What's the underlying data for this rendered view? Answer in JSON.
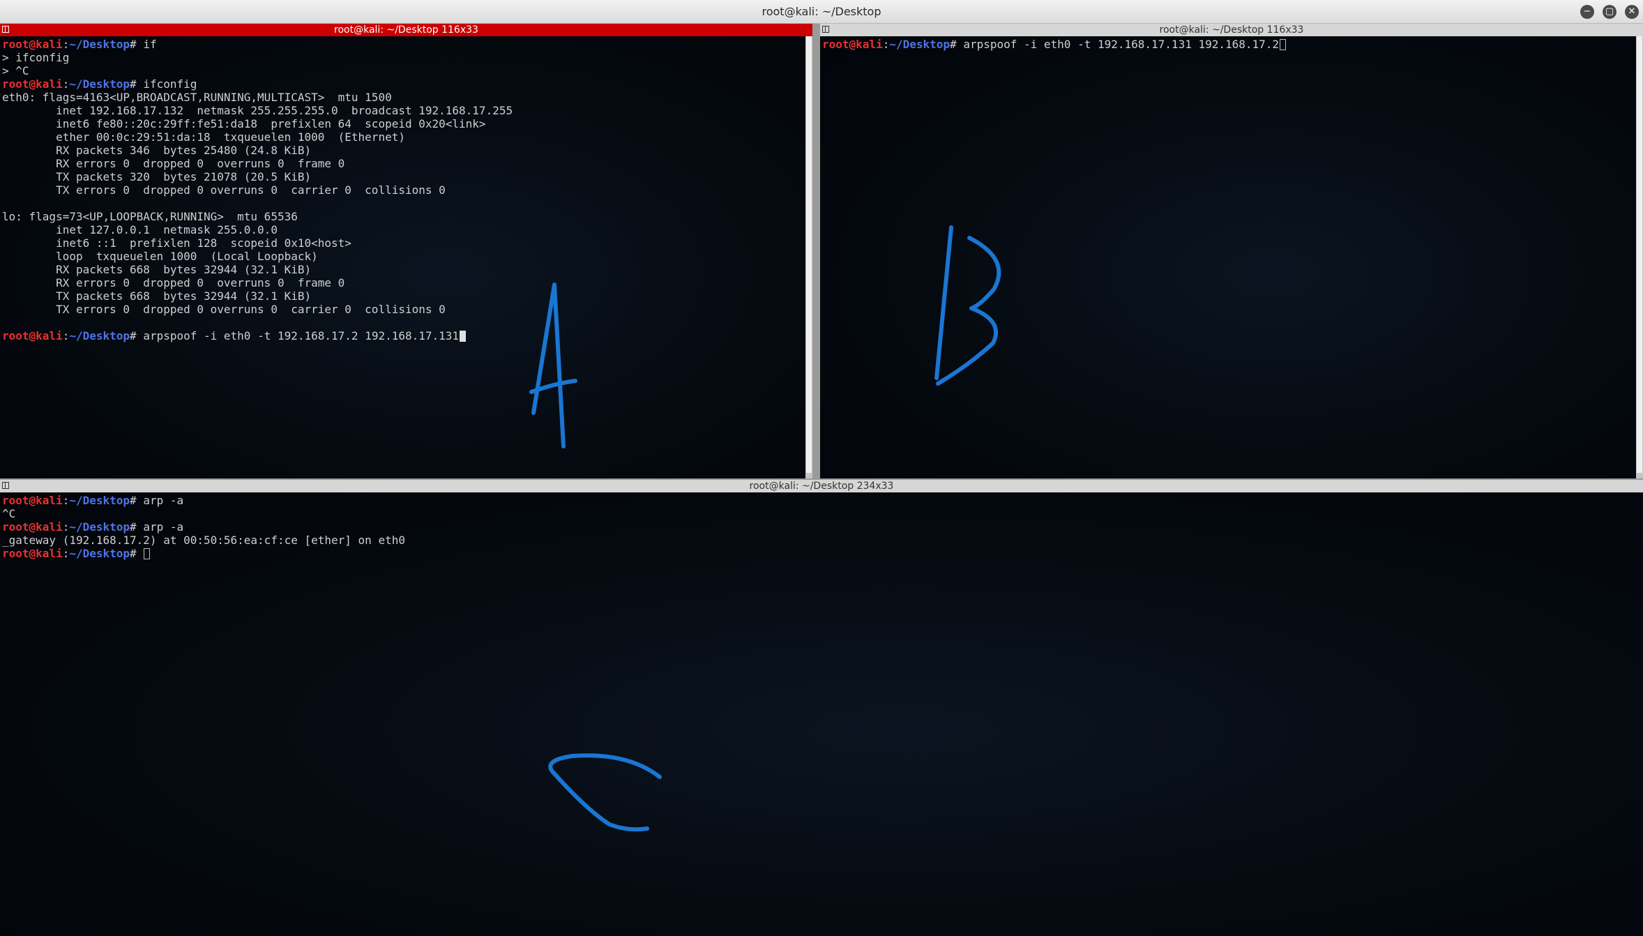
{
  "window": {
    "title": "root@kali: ~/Desktop",
    "buttons": {
      "minimize": "−",
      "maximize": "▢",
      "close": "✕"
    }
  },
  "colors": {
    "active_pane_header": "#cc0000",
    "user_prompt": "#e8312f",
    "path_prompt": "#4e73e6",
    "annotation": "#1a76d2"
  },
  "prompt": {
    "user": "root@kali",
    "sep": ":",
    "path": "~/Desktop",
    "symbol": "# "
  },
  "panes": {
    "top_left": {
      "header": "root@kali: ~/Desktop 116x33",
      "lines": [
        {
          "prompt": true,
          "text": "if"
        },
        {
          "text": "> ifconfig"
        },
        {
          "text": "> ^C"
        },
        {
          "prompt": true,
          "text": "ifconfig"
        },
        {
          "text": "eth0: flags=4163<UP,BROADCAST,RUNNING,MULTICAST>  mtu 1500"
        },
        {
          "text": "        inet 192.168.17.132  netmask 255.255.255.0  broadcast 192.168.17.255"
        },
        {
          "text": "        inet6 fe80::20c:29ff:fe51:da18  prefixlen 64  scopeid 0x20<link>"
        },
        {
          "text": "        ether 00:0c:29:51:da:18  txqueuelen 1000  (Ethernet)"
        },
        {
          "text": "        RX packets 346  bytes 25480 (24.8 KiB)"
        },
        {
          "text": "        RX errors 0  dropped 0  overruns 0  frame 0"
        },
        {
          "text": "        TX packets 320  bytes 21078 (20.5 KiB)"
        },
        {
          "text": "        TX errors 0  dropped 0 overruns 0  carrier 0  collisions 0"
        },
        {
          "text": ""
        },
        {
          "text": "lo: flags=73<UP,LOOPBACK,RUNNING>  mtu 65536"
        },
        {
          "text": "        inet 127.0.0.1  netmask 255.0.0.0"
        },
        {
          "text": "        inet6 ::1  prefixlen 128  scopeid 0x10<host>"
        },
        {
          "text": "        loop  txqueuelen 1000  (Local Loopback)"
        },
        {
          "text": "        RX packets 668  bytes 32944 (32.1 KiB)"
        },
        {
          "text": "        RX errors 0  dropped 0  overruns 0  frame 0"
        },
        {
          "text": "        TX packets 668  bytes 32944 (32.1 KiB)"
        },
        {
          "text": "        TX errors 0  dropped 0 overruns 0  carrier 0  collisions 0"
        },
        {
          "text": ""
        },
        {
          "prompt": true,
          "text": "arpspoof -i eth0 -t 192.168.17.2 192.168.17.131",
          "cursor": "solid"
        }
      ]
    },
    "top_right": {
      "header": "root@kali: ~/Desktop 116x33",
      "lines": [
        {
          "prompt": true,
          "text": "arpspoof -i eth0 -t 192.168.17.131 192.168.17.2",
          "cursor": "hollow"
        }
      ]
    },
    "bottom": {
      "header": "root@kali: ~/Desktop 234x33",
      "lines": [
        {
          "prompt": true,
          "text": "arp -a"
        },
        {
          "text": "^C"
        },
        {
          "prompt": true,
          "text": "arp -a"
        },
        {
          "text": "_gateway (192.168.17.2) at 00:50:56:ea:cf:ce [ether] on eth0"
        },
        {
          "prompt": true,
          "text": "",
          "cursor": "hollow"
        }
      ]
    }
  },
  "annotations": {
    "a": "A",
    "b": "B",
    "c": "C"
  }
}
